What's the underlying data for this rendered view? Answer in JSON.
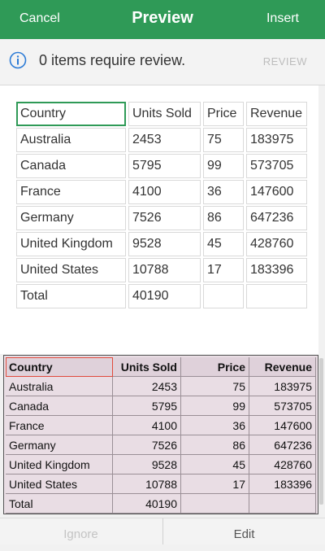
{
  "header": {
    "cancel": "Cancel",
    "title": "Preview",
    "insert": "Insert"
  },
  "review": {
    "message": "0 items require review.",
    "action": "REVIEW"
  },
  "table": {
    "columns": [
      "Country",
      "Units Sold",
      "Price",
      "Revenue"
    ],
    "rows": [
      [
        "Australia",
        "2453",
        "75",
        "183975"
      ],
      [
        "Canada",
        "5795",
        "99",
        "573705"
      ],
      [
        "France",
        "4100",
        "36",
        "147600"
      ],
      [
        "Germany",
        "7526",
        "86",
        "647236"
      ],
      [
        "United Kingdom",
        "9528",
        "45",
        "428760"
      ],
      [
        "United States",
        "10788",
        "17",
        "183396"
      ],
      [
        "Total",
        "40190",
        "",
        ""
      ]
    ]
  },
  "source": {
    "columns": [
      "Country",
      "Units Sold",
      "Price",
      "Revenue"
    ],
    "rows": [
      [
        "Australia",
        "2453",
        "75",
        "183975"
      ],
      [
        "Canada",
        "5795",
        "99",
        "573705"
      ],
      [
        "France",
        "4100",
        "36",
        "147600"
      ],
      [
        "Germany",
        "7526",
        "86",
        "647236"
      ],
      [
        "United Kingdom",
        "9528",
        "45",
        "428760"
      ],
      [
        "United States",
        "10788",
        "17",
        "183396"
      ],
      [
        "Total",
        "40190",
        "",
        ""
      ]
    ]
  },
  "bottom": {
    "ignore": "Ignore",
    "edit": "Edit"
  },
  "colors": {
    "accent": "#2f9a57",
    "info": "#2c7bd6",
    "selection_source": "#e04a3c"
  }
}
